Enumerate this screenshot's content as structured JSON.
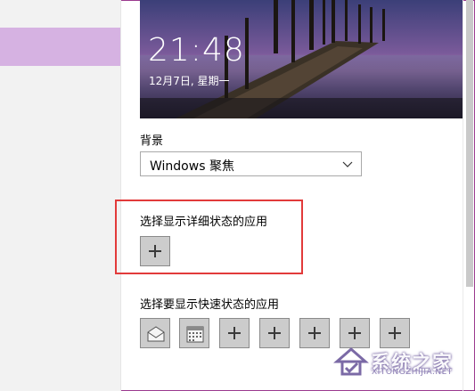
{
  "preview": {
    "time": "21:48",
    "date": "12月7日, 星期一"
  },
  "background": {
    "label": "背景",
    "selected": "Windows 聚焦"
  },
  "detailed_status": {
    "label": "选择显示详细状态的应用"
  },
  "quick_status": {
    "label": "选择要显示快速状态的应用",
    "tiles": [
      "mail-icon",
      "calendar-icon",
      "add",
      "add",
      "add",
      "add",
      "add"
    ]
  },
  "watermark": {
    "text": "系统之家",
    "sub": "XITONGZHIJIA.NET"
  },
  "colors": {
    "nav_selected": "#d6b2e2",
    "highlight_box": "#e23a3a",
    "tile_bg": "#cccccc"
  }
}
